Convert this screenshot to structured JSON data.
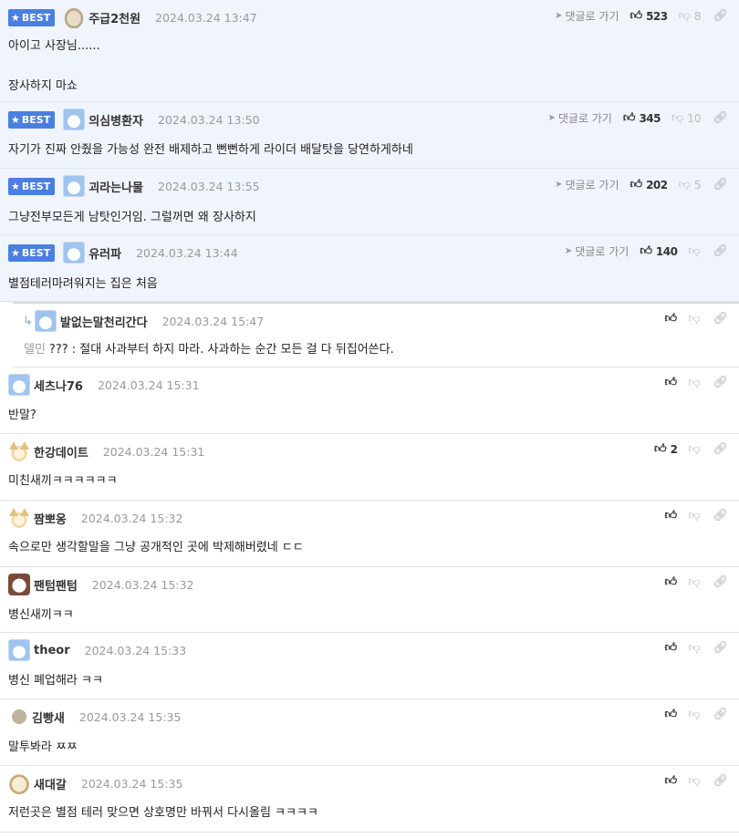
{
  "ui": {
    "best_label": "BEST",
    "goto_label": "댓글로 가기"
  },
  "comments": [
    {
      "best": true,
      "avatar": "rock-avatar",
      "nick": "주급2천원",
      "date": "2024.03.24 13:47",
      "lines": [
        "아이고 사장님......",
        "",
        "장사하지 마쇼"
      ],
      "likes": "523",
      "dislikes": "8"
    },
    {
      "best": true,
      "avatar": "polar-bear-avatar",
      "nick": "의심병환자",
      "date": "2024.03.24 13:50",
      "lines": [
        "자기가 진짜 안줬을 가능성 완전 배제하고 뻔뻔하게 라이더 배달탓을 당연하게하네"
      ],
      "likes": "345",
      "dislikes": "10"
    },
    {
      "best": true,
      "avatar": "polar-bear-avatar",
      "nick": "괴라는나물",
      "date": "2024.03.24 13:55",
      "lines": [
        "그냥전부모든게 남탓인거임. 그럴꺼면 왜 장사하지"
      ],
      "likes": "202",
      "dislikes": "5"
    },
    {
      "best": true,
      "avatar": "polar-bear-avatar",
      "nick": "유러파",
      "date": "2024.03.24 13:44",
      "lines": [
        "별점테러마려워지는 집은 처음"
      ],
      "likes": "140",
      "dislikes": ""
    },
    {
      "reply": true,
      "avatar": "polar-bear-avatar",
      "nick": "발없는말천리간다",
      "date": "2024.03.24 15:47",
      "to_user": "델민",
      "lines": [
        "??? : 절대 사과부터 하지 마라. 사과하는 순간 모든 걸 다 뒤집어쓴다."
      ],
      "likes": "",
      "dislikes": ""
    },
    {
      "avatar": "polar-bear-avatar",
      "nick": "세츠나76",
      "date": "2024.03.24 15:31",
      "lines": [
        "반말?"
      ],
      "likes": "",
      "dislikes": ""
    },
    {
      "avatar": "fox-avatar",
      "nick": "한강데이트",
      "date": "2024.03.24 15:31",
      "lines": [
        "미친새끼ㅋㅋㅋㅋㅋㅋ"
      ],
      "likes": "2",
      "dislikes": ""
    },
    {
      "avatar": "fox-avatar",
      "nick": "짬뽀옹",
      "date": "2024.03.24 15:32",
      "lines": [
        "속으로만 생각할말을 그냥 공개적인 곳에 박제해버렸네 ㄷㄷ"
      ],
      "likes": "",
      "dislikes": ""
    },
    {
      "avatar": "panda-avatar",
      "nick": "팬텀팬텀",
      "date": "2024.03.24 15:32",
      "lines": [
        "병신새끼ㅋㅋ"
      ],
      "likes": "",
      "dislikes": ""
    },
    {
      "avatar": "polar-bear-avatar",
      "nick": "theor",
      "date": "2024.03.24 15:33",
      "lines": [
        "병신 폐업해라 ㅋㅋ"
      ],
      "likes": "",
      "dislikes": ""
    },
    {
      "avatar": "dot-avatar",
      "nick": "김빵새",
      "date": "2024.03.24 15:35",
      "lines": [
        "말투봐라 ㅉㅉ"
      ],
      "likes": "",
      "dislikes": ""
    },
    {
      "avatar": "dog-avatar",
      "nick": "새대갈",
      "date": "2024.03.24 15:35",
      "lines": [
        "저런곳은 별점 테러 맞으면 상호명만 바꿔서 다시올림 ㅋㅋㅋㅋ"
      ],
      "likes": "",
      "dislikes": ""
    }
  ]
}
